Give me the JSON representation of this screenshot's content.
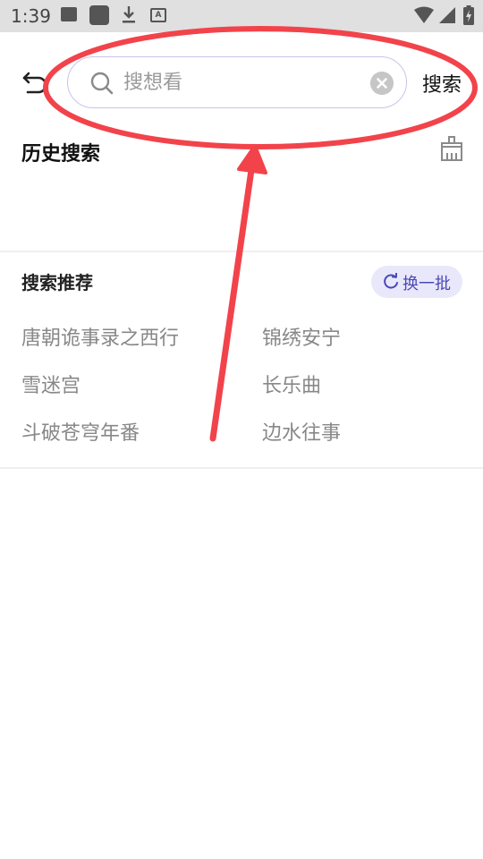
{
  "status_bar": {
    "time": "1:39",
    "a_badge": "A",
    "icons": [
      "image-icon",
      "app-icon",
      "download-icon",
      "a-badge-icon",
      "wifi-icon",
      "signal-icon",
      "battery-icon"
    ]
  },
  "header": {
    "back_icon": "back-arrow-icon",
    "search_placeholder": "搜想看",
    "search_value": "",
    "submit_label": "搜索"
  },
  "history": {
    "title": "历史搜索",
    "clear_icon": "broom-icon"
  },
  "recommend": {
    "title": "搜索推荐",
    "refresh_label": "换一批",
    "items": [
      "唐朝诡事录之西行",
      "锦绣安宁",
      "雪迷宫",
      "长乐曲",
      "斗破苍穹年番",
      "边水往事"
    ]
  },
  "colors": {
    "accent": "#4a48b8",
    "accent_bg": "#e9e8fb",
    "annotation_red": "#f2434b"
  }
}
